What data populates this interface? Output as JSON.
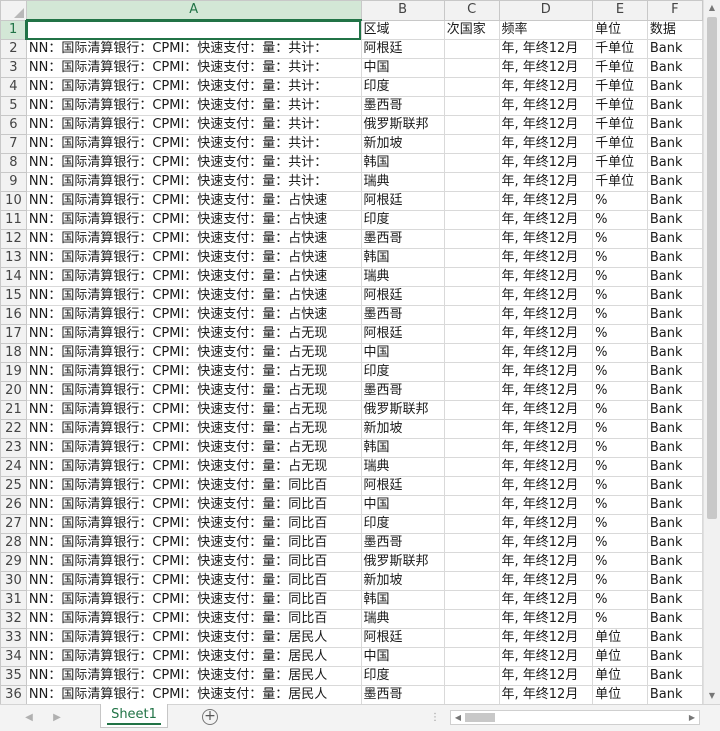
{
  "columns": [
    "A",
    "B",
    "C",
    "D",
    "E",
    "F"
  ],
  "header_row": {
    "row": "1",
    "cells": [
      "",
      "区域",
      "次国家",
      "频率",
      "单位",
      "数据"
    ]
  },
  "rows": [
    {
      "row": "2",
      "cells": [
        "NN：国际清算银行：CPMI：快速支付：量：共计：",
        "阿根廷",
        "",
        "年, 年终12月",
        "千单位",
        "Bank"
      ]
    },
    {
      "row": "3",
      "cells": [
        "NN：国际清算银行：CPMI：快速支付：量：共计：",
        "中国",
        "",
        "年, 年终12月",
        "千单位",
        "Bank"
      ]
    },
    {
      "row": "4",
      "cells": [
        "NN：国际清算银行：CPMI：快速支付：量：共计：",
        "印度",
        "",
        "年, 年终12月",
        "千单位",
        "Bank"
      ]
    },
    {
      "row": "5",
      "cells": [
        "NN：国际清算银行：CPMI：快速支付：量：共计：",
        "墨西哥",
        "",
        "年, 年终12月",
        "千单位",
        "Bank"
      ]
    },
    {
      "row": "6",
      "cells": [
        "NN：国际清算银行：CPMI：快速支付：量：共计：",
        "俄罗斯联邦",
        "",
        "年, 年终12月",
        "千单位",
        "Bank"
      ]
    },
    {
      "row": "7",
      "cells": [
        "NN：国际清算银行：CPMI：快速支付：量：共计：",
        "新加坡",
        "",
        "年, 年终12月",
        "千单位",
        "Bank"
      ]
    },
    {
      "row": "8",
      "cells": [
        "NN：国际清算银行：CPMI：快速支付：量：共计：",
        "韩国",
        "",
        "年, 年终12月",
        "千单位",
        "Bank"
      ]
    },
    {
      "row": "9",
      "cells": [
        "NN：国际清算银行：CPMI：快速支付：量：共计：",
        "瑞典",
        "",
        "年, 年终12月",
        "千单位",
        "Bank"
      ]
    },
    {
      "row": "10",
      "cells": [
        "NN：国际清算银行：CPMI：快速支付：量：占快速",
        "阿根廷",
        "",
        "年, 年终12月",
        "%",
        "Bank"
      ]
    },
    {
      "row": "11",
      "cells": [
        "NN：国际清算银行：CPMI：快速支付：量：占快速",
        "印度",
        "",
        "年, 年终12月",
        "%",
        "Bank"
      ]
    },
    {
      "row": "12",
      "cells": [
        "NN：国际清算银行：CPMI：快速支付：量：占快速",
        "墨西哥",
        "",
        "年, 年终12月",
        "%",
        "Bank"
      ]
    },
    {
      "row": "13",
      "cells": [
        "NN：国际清算银行：CPMI：快速支付：量：占快速",
        "韩国",
        "",
        "年, 年终12月",
        "%",
        "Bank"
      ]
    },
    {
      "row": "14",
      "cells": [
        "NN：国际清算银行：CPMI：快速支付：量：占快速",
        "瑞典",
        "",
        "年, 年终12月",
        "%",
        "Bank"
      ]
    },
    {
      "row": "15",
      "cells": [
        "NN：国际清算银行：CPMI：快速支付：量：占快速",
        "阿根廷",
        "",
        "年, 年终12月",
        "%",
        "Bank"
      ]
    },
    {
      "row": "16",
      "cells": [
        "NN：国际清算银行：CPMI：快速支付：量：占快速",
        "墨西哥",
        "",
        "年, 年终12月",
        "%",
        "Bank"
      ]
    },
    {
      "row": "17",
      "cells": [
        "NN：国际清算银行：CPMI：快速支付：量：占无现",
        "阿根廷",
        "",
        "年, 年终12月",
        "%",
        "Bank"
      ]
    },
    {
      "row": "18",
      "cells": [
        "NN：国际清算银行：CPMI：快速支付：量：占无现",
        "中国",
        "",
        "年, 年终12月",
        "%",
        "Bank"
      ]
    },
    {
      "row": "19",
      "cells": [
        "NN：国际清算银行：CPMI：快速支付：量：占无现",
        "印度",
        "",
        "年, 年终12月",
        "%",
        "Bank"
      ]
    },
    {
      "row": "20",
      "cells": [
        "NN：国际清算银行：CPMI：快速支付：量：占无现",
        "墨西哥",
        "",
        "年, 年终12月",
        "%",
        "Bank"
      ]
    },
    {
      "row": "21",
      "cells": [
        "NN：国际清算银行：CPMI：快速支付：量：占无现",
        "俄罗斯联邦",
        "",
        "年, 年终12月",
        "%",
        "Bank"
      ]
    },
    {
      "row": "22",
      "cells": [
        "NN：国际清算银行：CPMI：快速支付：量：占无现",
        "新加坡",
        "",
        "年, 年终12月",
        "%",
        "Bank"
      ]
    },
    {
      "row": "23",
      "cells": [
        "NN：国际清算银行：CPMI：快速支付：量：占无现",
        "韩国",
        "",
        "年, 年终12月",
        "%",
        "Bank"
      ]
    },
    {
      "row": "24",
      "cells": [
        "NN：国际清算银行：CPMI：快速支付：量：占无现",
        "瑞典",
        "",
        "年, 年终12月",
        "%",
        "Bank"
      ]
    },
    {
      "row": "25",
      "cells": [
        "NN：国际清算银行：CPMI：快速支付：量：同比百",
        "阿根廷",
        "",
        "年, 年终12月",
        "%",
        "Bank"
      ]
    },
    {
      "row": "26",
      "cells": [
        "NN：国际清算银行：CPMI：快速支付：量：同比百",
        "中国",
        "",
        "年, 年终12月",
        "%",
        "Bank"
      ]
    },
    {
      "row": "27",
      "cells": [
        "NN：国际清算银行：CPMI：快速支付：量：同比百",
        "印度",
        "",
        "年, 年终12月",
        "%",
        "Bank"
      ]
    },
    {
      "row": "28",
      "cells": [
        "NN：国际清算银行：CPMI：快速支付：量：同比百",
        "墨西哥",
        "",
        "年, 年终12月",
        "%",
        "Bank"
      ]
    },
    {
      "row": "29",
      "cells": [
        "NN：国际清算银行：CPMI：快速支付：量：同比百",
        "俄罗斯联邦",
        "",
        "年, 年终12月",
        "%",
        "Bank"
      ]
    },
    {
      "row": "30",
      "cells": [
        "NN：国际清算银行：CPMI：快速支付：量：同比百",
        "新加坡",
        "",
        "年, 年终12月",
        "%",
        "Bank"
      ]
    },
    {
      "row": "31",
      "cells": [
        "NN：国际清算银行：CPMI：快速支付：量：同比百",
        "韩国",
        "",
        "年, 年终12月",
        "%",
        "Bank"
      ]
    },
    {
      "row": "32",
      "cells": [
        "NN：国际清算银行：CPMI：快速支付：量：同比百",
        "瑞典",
        "",
        "年, 年终12月",
        "%",
        "Bank"
      ]
    },
    {
      "row": "33",
      "cells": [
        "NN：国际清算银行：CPMI：快速支付：量：居民人",
        "阿根廷",
        "",
        "年, 年终12月",
        "单位",
        "Bank"
      ]
    },
    {
      "row": "34",
      "cells": [
        "NN：国际清算银行：CPMI：快速支付：量：居民人",
        "中国",
        "",
        "年, 年终12月",
        "单位",
        "Bank"
      ]
    },
    {
      "row": "35",
      "cells": [
        "NN：国际清算银行：CPMI：快速支付：量：居民人",
        "印度",
        "",
        "年, 年终12月",
        "单位",
        "Bank"
      ]
    },
    {
      "row": "36",
      "cells": [
        "NN：国际清算银行：CPMI：快速支付：量：居民人",
        "墨西哥",
        "",
        "年, 年终12月",
        "单位",
        "Bank"
      ]
    }
  ],
  "sheet_tabs": [
    {
      "label": "Sheet1",
      "active": true
    }
  ],
  "add_sheet_symbol": "+",
  "icons": {
    "tab_prev": "◀",
    "tab_next": "▶",
    "scroll_up": "▲",
    "scroll_down": "▼",
    "scroll_left": "◀",
    "scroll_right": "▶",
    "split_handle": "⋮"
  },
  "colors": {
    "accent": "#217346",
    "header_bg": "#f2f2f2",
    "selected_header_bg": "#d3e7d6",
    "gridline": "#d9d9d9"
  }
}
